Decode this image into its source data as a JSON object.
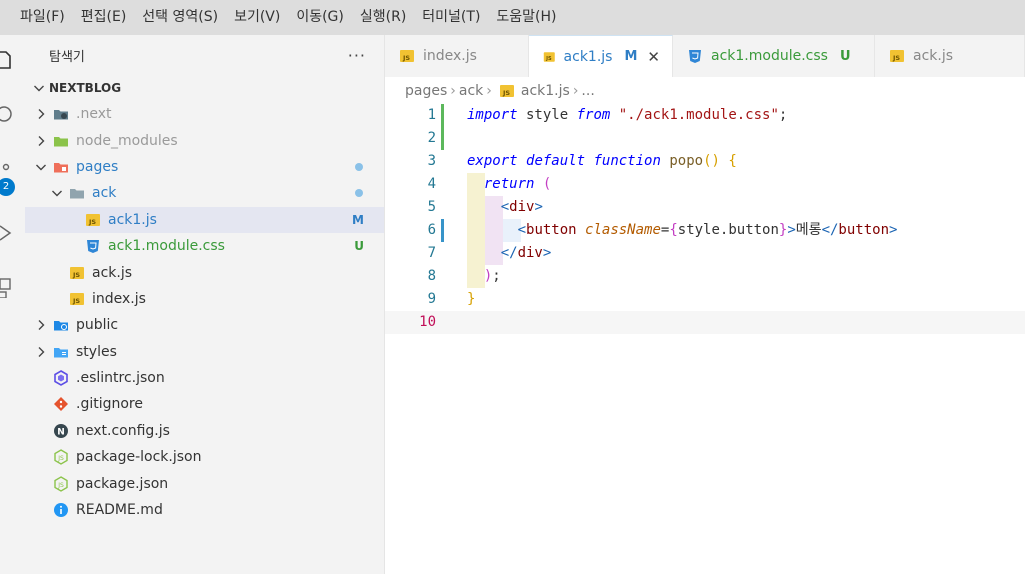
{
  "menubar": {
    "items": [
      "파일(F)",
      "편집(E)",
      "선택 영역(S)",
      "보기(V)",
      "이동(G)",
      "실행(R)",
      "터미널(T)",
      "도움말(H)"
    ]
  },
  "activitybar": {
    "badge": "2"
  },
  "sidebar": {
    "title": "탐색기",
    "more": "···",
    "folder": "NEXTBLOG",
    "tree": [
      {
        "label": ".next",
        "depth": 1,
        "kind": "folder",
        "icon": "next-folder-icon",
        "expanded": false,
        "color": "gray"
      },
      {
        "label": "node_modules",
        "depth": 1,
        "kind": "folder",
        "icon": "node-folder-icon",
        "expanded": false,
        "color": "gray"
      },
      {
        "label": "pages",
        "depth": 1,
        "kind": "folder",
        "icon": "pages-folder-icon",
        "expanded": true,
        "color": "blue",
        "dot": true
      },
      {
        "label": "ack",
        "depth": 2,
        "kind": "folder",
        "icon": "folder-icon",
        "expanded": true,
        "color": "blue",
        "dot": true
      },
      {
        "label": "ack1.js",
        "depth": 3,
        "kind": "file",
        "icon": "js-file-icon",
        "color": "blue",
        "status": "M",
        "selected": true
      },
      {
        "label": "ack1.module.css",
        "depth": 3,
        "kind": "file",
        "icon": "css-file-icon",
        "color": "green",
        "status": "U"
      },
      {
        "label": "ack.js",
        "depth": 2,
        "kind": "file",
        "icon": "js-file-icon",
        "color": "default"
      },
      {
        "label": "index.js",
        "depth": 2,
        "kind": "file",
        "icon": "js-file-icon",
        "color": "default"
      },
      {
        "label": "public",
        "depth": 1,
        "kind": "folder",
        "icon": "public-folder-icon",
        "expanded": false,
        "color": "default"
      },
      {
        "label": "styles",
        "depth": 1,
        "kind": "folder",
        "icon": "styles-folder-icon",
        "expanded": false,
        "color": "default"
      },
      {
        "label": ".eslintrc.json",
        "depth": 1,
        "kind": "file",
        "icon": "eslint-icon",
        "color": "default"
      },
      {
        "label": ".gitignore",
        "depth": 1,
        "kind": "file",
        "icon": "git-icon",
        "color": "default"
      },
      {
        "label": "next.config.js",
        "depth": 1,
        "kind": "file",
        "icon": "next-icon",
        "color": "default"
      },
      {
        "label": "package-lock.json",
        "depth": 1,
        "kind": "file",
        "icon": "node-json-icon",
        "color": "default"
      },
      {
        "label": "package.json",
        "depth": 1,
        "kind": "file",
        "icon": "node-json-icon",
        "color": "default"
      },
      {
        "label": "README.md",
        "depth": 1,
        "kind": "file",
        "icon": "info-icon",
        "color": "default"
      }
    ]
  },
  "tabs": [
    {
      "label": "index.js",
      "icon": "js-file-icon",
      "active": false,
      "status": ""
    },
    {
      "label": "ack1.js",
      "icon": "js-file-icon",
      "active": true,
      "status": "M",
      "close": "✕"
    },
    {
      "label": "ack1.module.css",
      "icon": "css-file-icon",
      "active": false,
      "status": "U"
    },
    {
      "label": "ack.js",
      "icon": "js-file-icon",
      "active": false,
      "status": ""
    }
  ],
  "breadcrumb": [
    "pages",
    "ack",
    "ack1.js",
    "..."
  ],
  "code": {
    "current_line": 10,
    "lines": [
      {
        "n": "1",
        "mark": "add",
        "tokens": [
          [
            "kw",
            "import"
          ],
          [
            "plain",
            " style "
          ],
          [
            "kw",
            "from"
          ],
          [
            "plain",
            " "
          ],
          [
            "str",
            "\"./ack1.module.css\""
          ],
          [
            "plain",
            ";"
          ]
        ]
      },
      {
        "n": "2",
        "mark": "add",
        "tokens": []
      },
      {
        "n": "3",
        "tokens": [
          [
            "kw",
            "export"
          ],
          [
            "plain",
            " "
          ],
          [
            "kw",
            "default"
          ],
          [
            "plain",
            " "
          ],
          [
            "kw",
            "function"
          ],
          [
            "plain",
            " "
          ],
          [
            "fn",
            "popo"
          ],
          [
            "p1",
            "()"
          ],
          [
            "plain",
            " "
          ],
          [
            "p1",
            "{"
          ]
        ]
      },
      {
        "n": "4",
        "tokens": [
          [
            "plain",
            "  "
          ],
          [
            "kw",
            "return"
          ],
          [
            "plain",
            " "
          ],
          [
            "p2",
            "("
          ]
        ]
      },
      {
        "n": "5",
        "tokens": [
          [
            "plain",
            "    "
          ],
          [
            "tagp",
            "<"
          ],
          [
            "tag",
            "div"
          ],
          [
            "tagp",
            ">"
          ]
        ]
      },
      {
        "n": "6",
        "mark": "mod",
        "tokens": [
          [
            "plain",
            "      "
          ],
          [
            "tagp",
            "<"
          ],
          [
            "tag",
            "button"
          ],
          [
            "plain",
            " "
          ],
          [
            "attr",
            "className"
          ],
          [
            "plain",
            "="
          ],
          [
            "p2",
            "{"
          ],
          [
            "plain",
            "style.button"
          ],
          [
            "p2",
            "}"
          ],
          [
            "tagp",
            ">"
          ],
          [
            "plain",
            "메롱"
          ],
          [
            "tagp",
            "</"
          ],
          [
            "tag",
            "button"
          ],
          [
            "tagp",
            ">"
          ]
        ]
      },
      {
        "n": "7",
        "tokens": [
          [
            "plain",
            "    "
          ],
          [
            "tagp",
            "</"
          ],
          [
            "tag",
            "div"
          ],
          [
            "tagp",
            ">"
          ]
        ]
      },
      {
        "n": "8",
        "tokens": [
          [
            "plain",
            "  "
          ],
          [
            "p2",
            ")"
          ],
          [
            "plain",
            ";"
          ]
        ]
      },
      {
        "n": "9",
        "tokens": [
          [
            "p1",
            "}"
          ]
        ]
      },
      {
        "n": "10",
        "tokens": []
      }
    ]
  }
}
